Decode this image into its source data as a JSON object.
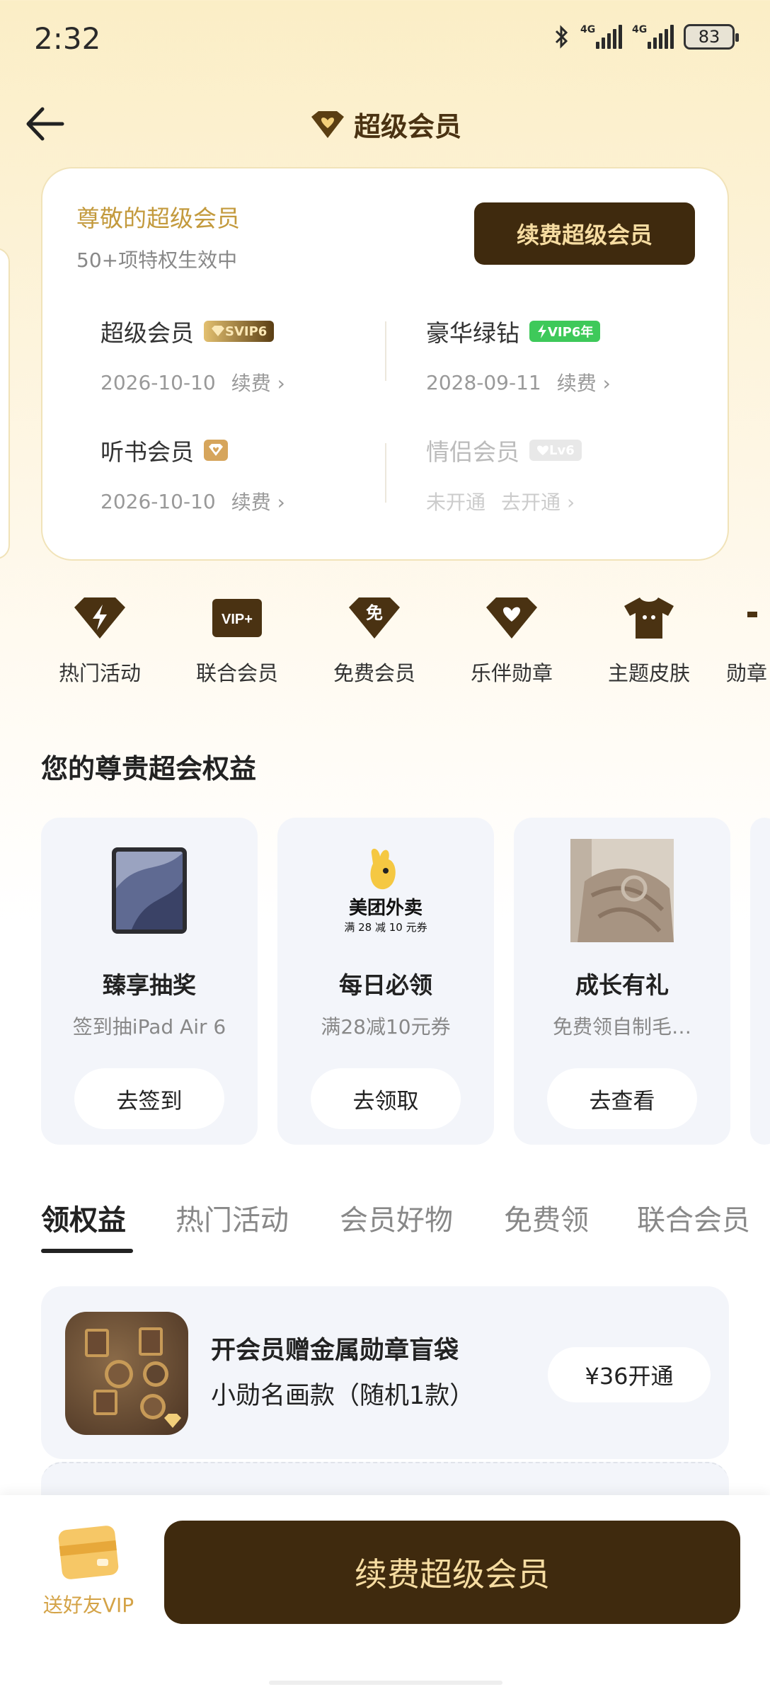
{
  "status": {
    "time": "2:32",
    "network1": "4G",
    "network2": "4G",
    "battery": "83"
  },
  "nav": {
    "title": "超级会员"
  },
  "member_card": {
    "greeting": "尊敬的超级会员",
    "subtitle": "50+项特权生效中",
    "renew_label": "续费超级会员",
    "items": [
      {
        "name": "超级会员",
        "badge": "SVIP6",
        "date": "2026-10-10",
        "action": "续费"
      },
      {
        "name": "豪华绿钻",
        "badge": "VIP6年",
        "date": "2028-09-11",
        "action": "续费"
      },
      {
        "name": "听书会员",
        "badge": "",
        "date": "2026-10-10",
        "action": "续费"
      },
      {
        "name": "情侣会员",
        "badge": "Lv6",
        "date": "未开通",
        "action": "去开通"
      }
    ]
  },
  "shortcuts": [
    {
      "label": "热门活动",
      "icon": "lightning-diamond-icon"
    },
    {
      "label": "联合会员",
      "icon": "vip-plus-icon",
      "icon_text": "VIP+"
    },
    {
      "label": "免费会员",
      "icon": "free-diamond-icon",
      "icon_text": "免"
    },
    {
      "label": "乐伴勋章",
      "icon": "heart-diamond-icon"
    },
    {
      "label": "主题皮肤",
      "icon": "tshirt-icon"
    },
    {
      "label": "勋章",
      "icon": "partial-icon"
    }
  ],
  "benefits": {
    "title": "您的尊贵超会权益",
    "cards": [
      {
        "title": "臻享抽奖",
        "desc": "签到抽iPad Air 6",
        "button": "去签到",
        "image": "ipad-image"
      },
      {
        "title": "每日必领",
        "desc": "满28减10元券",
        "button": "去领取",
        "image": "meituan-image",
        "brand": "美团外卖",
        "brand_sub": "满 28 减 10 元券"
      },
      {
        "title": "成长有礼",
        "desc": "免费领自制毛…",
        "button": "去查看",
        "image": "blanket-image"
      }
    ]
  },
  "tabs": [
    "领权益",
    "热门活动",
    "会员好物",
    "免费领",
    "联合会员"
  ],
  "products": [
    {
      "title": "开会员赠金属勋章盲袋",
      "subtitle": "小勋名画款（随机1款）",
      "button": "¥36开通"
    }
  ],
  "bottom": {
    "gift_label": "送好友VIP",
    "main_button": "续费超级会员"
  },
  "colors": {
    "brand_dark": "#3f2a0e",
    "gold": "#c39a3d",
    "green_vip": "#3ec95a"
  }
}
